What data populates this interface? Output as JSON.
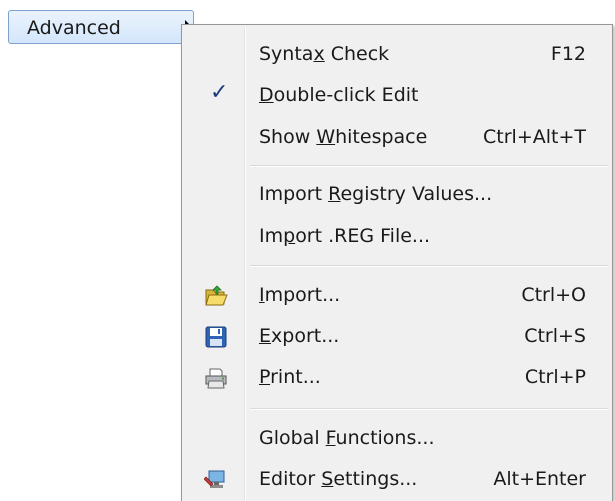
{
  "parent": {
    "label": "Advanced"
  },
  "menu": {
    "syntax_check": {
      "pre": "Synta",
      "ul": "x",
      "post": " Check",
      "shortcut": "F12"
    },
    "double_click_edit": {
      "pre": "",
      "ul": "D",
      "post": "ouble-click Edit",
      "checked": true
    },
    "show_whitespace": {
      "pre": "Show ",
      "ul": "W",
      "post": "hitespace",
      "shortcut": "Ctrl+Alt+T"
    },
    "import_registry": {
      "pre": "Import ",
      "ul": "R",
      "post": "egistry Values..."
    },
    "import_reg_file": {
      "pre": "Im",
      "ul": "p",
      "post": "ort .REG File..."
    },
    "import": {
      "pre": "",
      "ul": "I",
      "post": "mport...",
      "shortcut": "Ctrl+O",
      "icon": "folder-open-icon"
    },
    "export": {
      "pre": "",
      "ul": "E",
      "post": "xport...",
      "shortcut": "Ctrl+S",
      "icon": "floppy-disk-icon"
    },
    "print": {
      "pre": "",
      "ul": "P",
      "post": "rint...",
      "shortcut": "Ctrl+P",
      "icon": "printer-icon"
    },
    "global_functions": {
      "pre": "Global ",
      "ul": "F",
      "post": "unctions..."
    },
    "editor_settings": {
      "pre": "Editor ",
      "ul": "S",
      "post": "ettings...",
      "shortcut": "Alt+Enter",
      "icon": "settings-monitor-icon"
    }
  },
  "colors": {
    "highlight_border": "#7da2ce",
    "menu_bg": "#f0f0f0",
    "check": "#1d3e7a"
  }
}
